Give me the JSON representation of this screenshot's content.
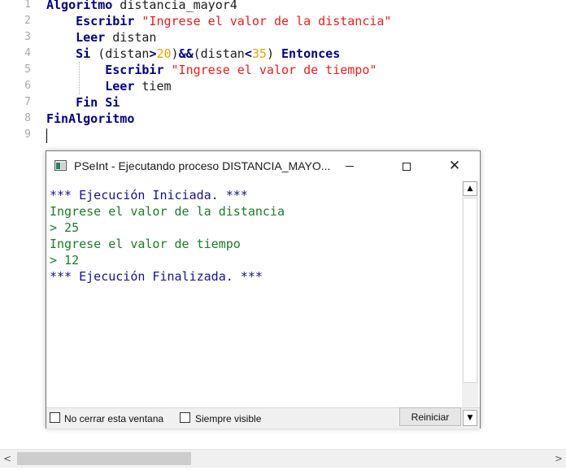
{
  "editor": {
    "line_numbers": [
      "1",
      "2",
      "3",
      "4",
      "5",
      "6",
      "7",
      "8",
      "9"
    ],
    "lines": [
      [
        {
          "t": "Algoritmo",
          "c": "kw"
        },
        {
          "t": " distancia_mayor4",
          "c": "plain"
        }
      ],
      [
        {
          "t": "    ",
          "c": "plain"
        },
        {
          "t": "Escribir",
          "c": "kw"
        },
        {
          "t": " ",
          "c": "plain"
        },
        {
          "t": "\"Ingrese el valor de la distancia\"",
          "c": "str"
        }
      ],
      [
        {
          "t": "    ",
          "c": "plain"
        },
        {
          "t": "Leer",
          "c": "kw"
        },
        {
          "t": " distan",
          "c": "plain"
        }
      ],
      [
        {
          "t": "    ",
          "c": "plain"
        },
        {
          "t": "Si",
          "c": "kw"
        },
        {
          "t": " (distan",
          "c": "plain"
        },
        {
          "t": ">",
          "c": "kw"
        },
        {
          "t": "20",
          "c": "num"
        },
        {
          "t": ")",
          "c": "plain"
        },
        {
          "t": "&&",
          "c": "kw"
        },
        {
          "t": "(distan",
          "c": "plain"
        },
        {
          "t": "<",
          "c": "kw"
        },
        {
          "t": "35",
          "c": "num"
        },
        {
          "t": ") ",
          "c": "plain"
        },
        {
          "t": "Entonces",
          "c": "kw"
        }
      ],
      [
        {
          "t": "        ",
          "c": "plain"
        },
        {
          "t": "Escribir",
          "c": "kw"
        },
        {
          "t": " ",
          "c": "plain"
        },
        {
          "t": "\"Ingrese el valor de tiempo\"",
          "c": "str"
        }
      ],
      [
        {
          "t": "        ",
          "c": "plain"
        },
        {
          "t": "Leer",
          "c": "kw"
        },
        {
          "t": " tiem",
          "c": "plain"
        }
      ],
      [
        {
          "t": "    ",
          "c": "plain"
        },
        {
          "t": "Fin Si",
          "c": "kw"
        }
      ],
      [
        {
          "t": "FinAlgoritmo",
          "c": "kw"
        }
      ],
      []
    ]
  },
  "exec_window": {
    "title": "PSeInt - Ejecutando proceso DISTANCIA_MAYO...",
    "console_lines": [
      {
        "text": "*** Ejecución Iniciada. ***",
        "color": "blue"
      },
      {
        "text": "Ingrese el valor de la distancia",
        "color": "green"
      },
      {
        "text": "> 25",
        "color": "green"
      },
      {
        "text": "Ingrese el valor de tiempo",
        "color": "green"
      },
      {
        "text": "> 12",
        "color": "green"
      },
      {
        "text": "*** Ejecución Finalizada. ***",
        "color": "blue"
      }
    ],
    "no_close_label": "No cerrar esta ventana",
    "always_visible_label": "Siempre visible",
    "reset_label": "Reiniciar",
    "close_glyph": "✕",
    "scroll_up_glyph": "▲",
    "scroll_down_glyph": "▼"
  },
  "hscroll": {
    "left_glyph": "<",
    "right_glyph": ">"
  },
  "colors": {
    "keyword": "#00007f",
    "string": "#e81e1e",
    "number": "#e0a400",
    "console_blue": "#15138a",
    "console_green": "#1e7a2a"
  },
  "icons": [
    "pseint-app-icon",
    "minimize-icon",
    "maximize-icon",
    "close-icon",
    "scroll-up-icon",
    "scroll-down-icon",
    "scroll-left-icon",
    "scroll-right-icon"
  ]
}
